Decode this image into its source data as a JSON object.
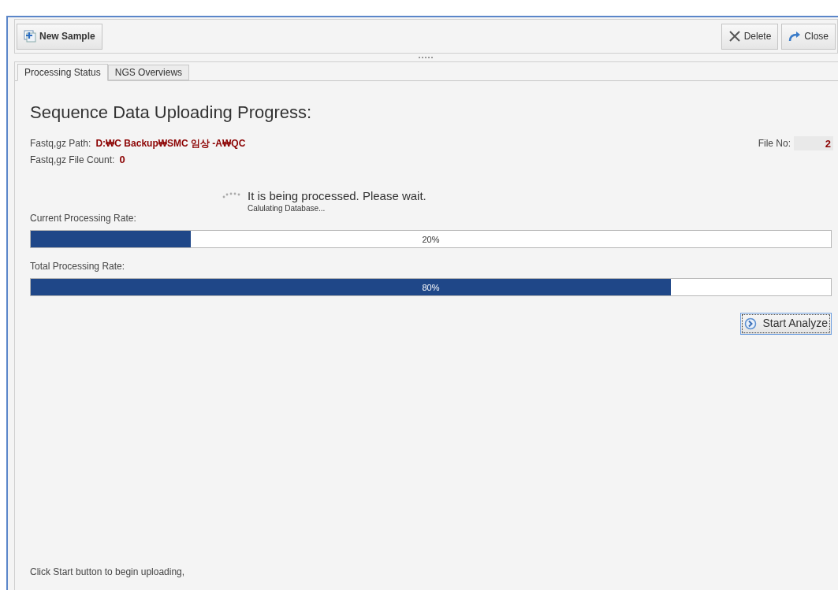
{
  "toolbar": {
    "left_buttons": [
      {
        "label": "New Sample",
        "kind": "new"
      }
    ],
    "right_buttons": [
      {
        "label": "Delete",
        "kind": "delete"
      },
      {
        "label": "Close",
        "kind": "close"
      }
    ]
  },
  "tabs": [
    {
      "label": "Processing Status",
      "selected": true
    },
    {
      "label": "NGS Overviews",
      "selected": false
    }
  ],
  "heading": "Sequence Data Uploading Progress:",
  "path": {
    "label": "Fastq,gz Path:",
    "value": "D:₩C Backup₩SMC 임상 -A₩QC"
  },
  "file_count": {
    "label": "Fastq,gz File Count:",
    "value": "0"
  },
  "file_no": {
    "label": "File No:",
    "value": "2"
  },
  "wait": {
    "message": "It is being processed. Please wait.",
    "detail": "Calulating Database..."
  },
  "progress": [
    {
      "label": "Current Processing Rate:",
      "level": 0.2,
      "reading": "20%"
    },
    {
      "label": "Total Processing Rate:",
      "level": 0.8,
      "reading": "80%"
    }
  ],
  "start_button": {
    "label": "Start Analyze"
  },
  "status": "Click Start button to begin uploading,"
}
